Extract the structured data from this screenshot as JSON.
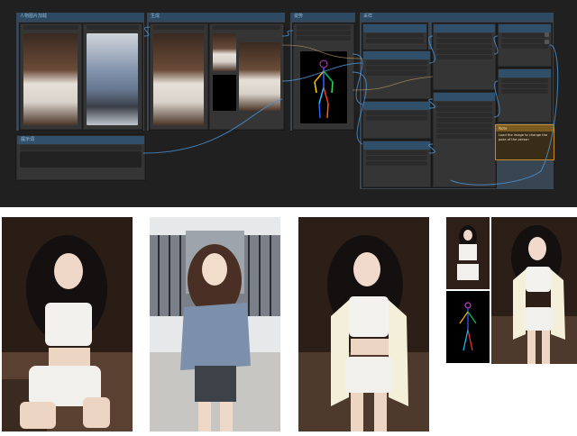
{
  "canvas": {
    "groups": [
      {
        "title": "人物图片加载"
      },
      {
        "title": "生成"
      },
      {
        "title": "姿势"
      },
      {
        "title": "采样"
      }
    ],
    "note": {
      "title": "Note",
      "text": "Load the image to change the pose of the person"
    },
    "text_node": {
      "title": "提示词"
    }
  },
  "gallery": {
    "images": [
      {
        "label": "Reference seated portrait"
      },
      {
        "label": "Pose source portrait"
      },
      {
        "label": "Generated result"
      },
      {
        "label": "Comparison with pose skeleton"
      }
    ]
  },
  "colors": {
    "canvas_bg": "#202020",
    "node_bg": "#353535",
    "group_bg": "#3b4a5a",
    "wire_blue": "#4a90d0",
    "note_border": "#c58a2a"
  }
}
